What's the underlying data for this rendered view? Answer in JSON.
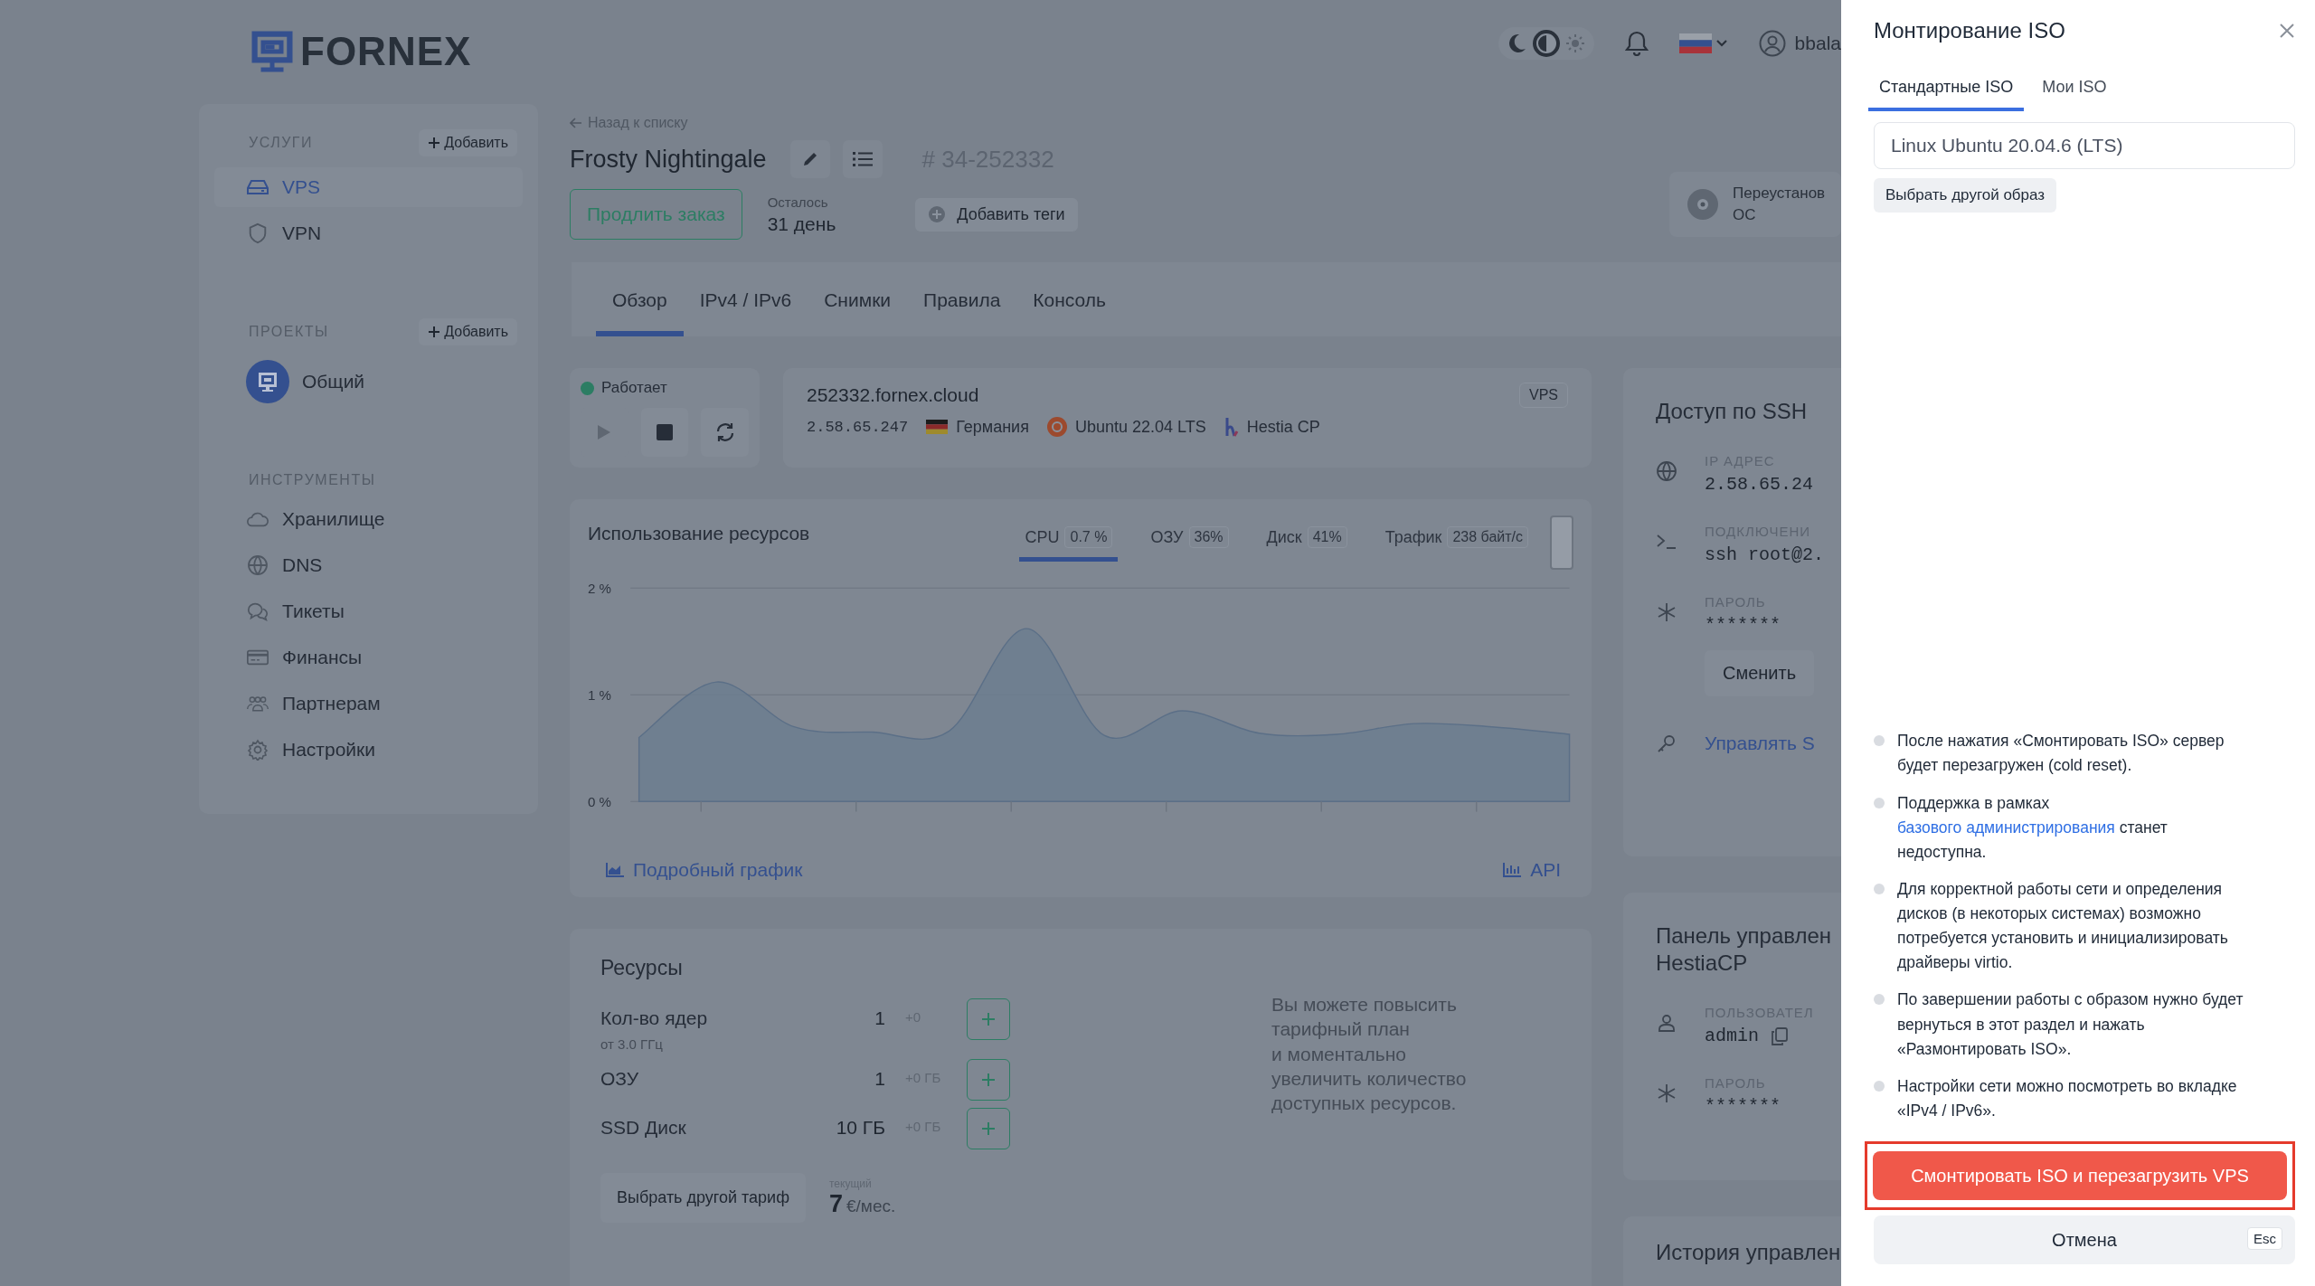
{
  "header": {
    "logo": "FORNEX",
    "theme_modes": [
      {
        "kind": "dark",
        "selected": false
      },
      {
        "kind": "auto",
        "selected": true
      },
      {
        "kind": "light",
        "selected": false
      }
    ],
    "user": "bbala"
  },
  "sidebar": {
    "sections": [
      {
        "title": "УСЛУГИ",
        "add": "Добавить",
        "items": [
          {
            "label": "VPS",
            "kind": "server",
            "selected": true
          },
          {
            "label": "VPN",
            "kind": "shield",
            "selected": false
          }
        ]
      },
      {
        "title": "ПРОЕКТЫ",
        "add": "Добавить",
        "items": [
          {
            "label": "Общий",
            "kind": "avatar",
            "selected": false
          }
        ]
      },
      {
        "title": "ИНСТРУМЕНТЫ",
        "items": [
          {
            "label": "Хранилище",
            "kind": "cloud",
            "selected": false
          },
          {
            "label": "DNS",
            "kind": "globe",
            "selected": false
          },
          {
            "label": "Тикеты",
            "kind": "chat",
            "selected": false
          },
          {
            "label": "Финансы",
            "kind": "card",
            "selected": false
          },
          {
            "label": "Партнерам",
            "kind": "people",
            "selected": false
          },
          {
            "label": "Настройки",
            "kind": "gear",
            "selected": false
          }
        ]
      }
    ]
  },
  "server": {
    "back": "Назад к списку",
    "name": "Frosty Nightingale",
    "order_id": "# 34-252332",
    "renew": "Продлить заказ",
    "remaining_label": "Осталось",
    "remaining": "31 день",
    "add_tags": "Добавить теги",
    "reinstall": [
      "Переустанов",
      "ОС"
    ]
  },
  "tabs": [
    {
      "label": "Обзор",
      "selected": true
    },
    {
      "label": "IPv4 / IPv6",
      "selected": false
    },
    {
      "label": "Снимки",
      "selected": false
    },
    {
      "label": "Правила",
      "selected": false
    },
    {
      "label": "Консоль",
      "selected": false
    }
  ],
  "status": {
    "label": "Работает",
    "running": true
  },
  "host": {
    "name": "252332.fornex.cloud",
    "type": "VPS",
    "ip": "2.58.65.247",
    "location": "Германия",
    "os": "Ubuntu 22.04 LTS",
    "panel": "Hestia CP"
  },
  "usage": {
    "title": "Использование ресурсов",
    "metrics": [
      {
        "label": "CPU",
        "value": "0.7 %",
        "selected": true
      },
      {
        "label": "ОЗУ",
        "value": "36%",
        "selected": false
      },
      {
        "label": "Диск",
        "value": "41%",
        "selected": false
      },
      {
        "label": "Трафик",
        "value": "238 байт/с",
        "selected": false
      }
    ],
    "chart_data": {
      "type": "area",
      "ylim": [
        0,
        2
      ],
      "yticks": [
        {
          "value": 0,
          "label": "0 %"
        },
        {
          "value": 1,
          "label": "1 %"
        },
        {
          "value": 2,
          "label": "2 %"
        }
      ],
      "values": [
        0.6,
        1.12,
        0.7,
        0.65,
        0.66,
        1.62,
        0.62,
        0.85,
        0.64,
        0.63,
        0.73,
        0.7,
        0.63
      ]
    },
    "details_link": "Подробный график",
    "api_link": "API"
  },
  "resources": {
    "title": "Ресурсы",
    "rows": [
      {
        "label": "Кол-во ядер",
        "sub": "от 3.0 ГГц",
        "value": "1",
        "delta": "+0"
      },
      {
        "label": "ОЗУ",
        "value": "1",
        "delta": "+0 ГБ"
      },
      {
        "label": "SSD Диск",
        "value": "10 ГБ",
        "delta": "+0 ГБ"
      }
    ],
    "change_plan": "Выбрать другой тариф",
    "price_label": "текущий",
    "price": "7",
    "price_unit": "€/мес.",
    "tip": "Вы можете повысить\nтарифный план\nи моментально\nувеличить количество\nдоступных ресурсов."
  },
  "ssh": {
    "title": "Доступ по SSH",
    "rows": [
      {
        "kind": "globe",
        "label": "IP АДРЕС",
        "value": "2.58.65.24"
      },
      {
        "kind": "terminal",
        "label": "ПОДКЛЮЧЕНИ",
        "value": "ssh root@2."
      },
      {
        "kind": "asterisk",
        "label": "ПАРОЛЬ",
        "value": "*******",
        "action": "Сменить"
      }
    ],
    "manage_link": "Управлять S"
  },
  "panel": {
    "title": [
      "Панель управлен",
      "HestiaCP"
    ],
    "rows": [
      {
        "kind": "user",
        "label": "ПОЛЬЗОВАТЕЛ",
        "value": "admin",
        "copy": true
      },
      {
        "kind": "asterisk",
        "label": "ПАРОЛЬ",
        "value": "*******",
        "copy": false
      }
    ]
  },
  "history": {
    "title": "История управлен"
  },
  "drawer": {
    "title": "Монтирование ISO",
    "tabs": [
      {
        "label": "Стандартные ISO",
        "selected": true
      },
      {
        "label": "Мои ISO",
        "selected": false
      }
    ],
    "image": "Linux Ubuntu 20.04.6 (LTS)",
    "choose": "Выбрать другой образ",
    "notes": [
      {
        "parts": [
          {
            "text": "После нажатия «Смонтировать ISO» сервер будет перезагружен (cold reset).",
            "link": false
          }
        ]
      },
      {
        "parts": [
          {
            "text": "Поддержка в рамках ",
            "link": false
          },
          {
            "text": "базового администрирования",
            "link": true
          },
          {
            "text": " станет недоступна.",
            "link": false
          }
        ]
      },
      {
        "parts": [
          {
            "text": "Для корректной работы сети и определения дисков (в некоторых системах) возможно потребуется установить и инициализировать драйверы virtio.",
            "link": false
          }
        ]
      },
      {
        "parts": [
          {
            "text": "По завершении работы с образом нужно будет вернуться в этот раздел и нажать «Размонтировать ISO».",
            "link": false
          }
        ]
      },
      {
        "parts": [
          {
            "text": "Настройки сети можно посмотреть во вкладке «IPv4 / IPv6».",
            "link": false
          }
        ]
      }
    ],
    "confirm": "Смонтировать ISO и перезагрузить VPS",
    "confirm_highlighted": true,
    "cancel": "Отмена",
    "cancel_key": "Esc"
  }
}
